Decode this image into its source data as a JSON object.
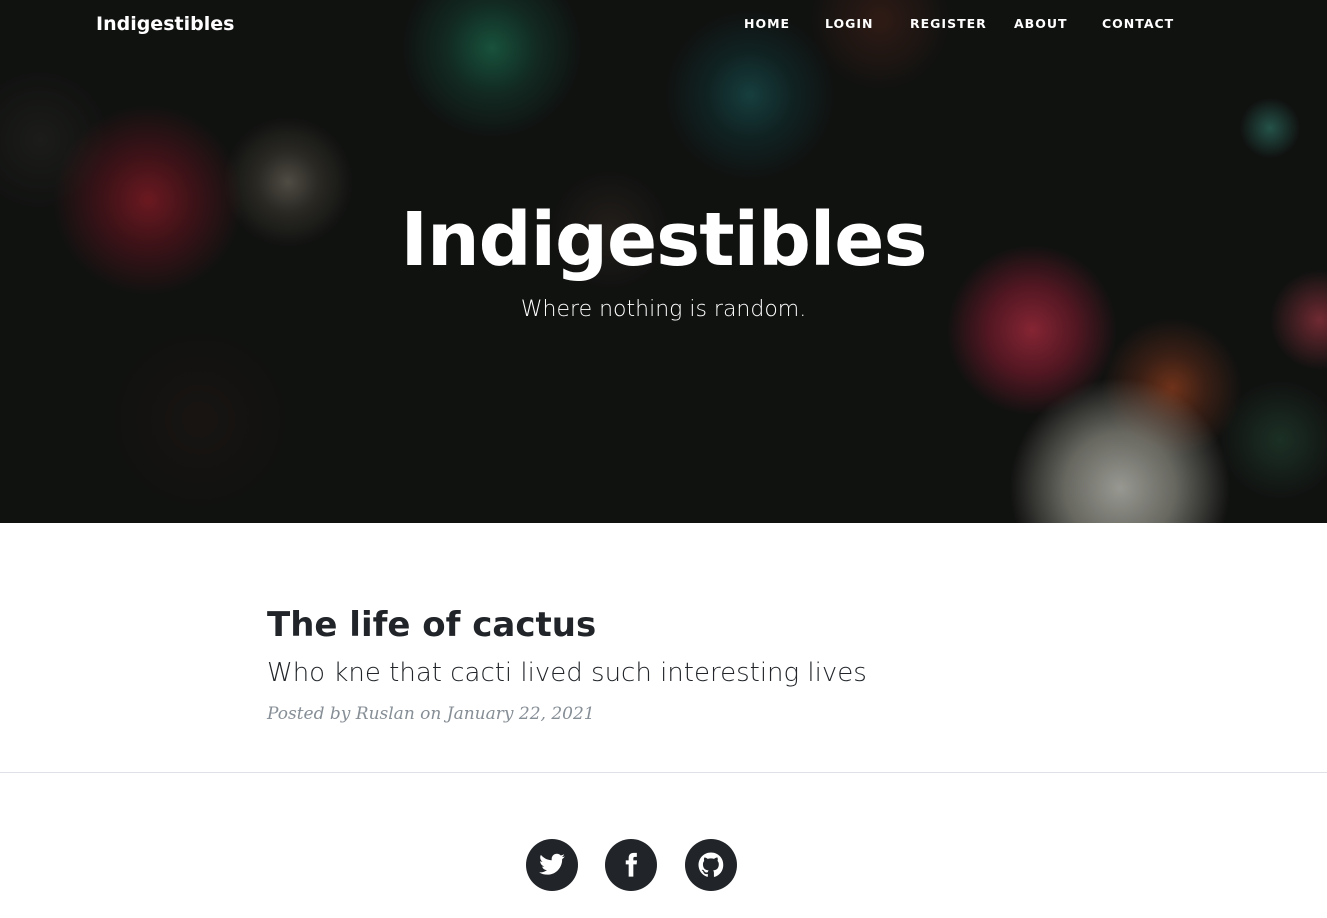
{
  "navbar": {
    "brand": "Indigestibles",
    "items": [
      {
        "label": "HOME"
      },
      {
        "label": "LOGIN"
      },
      {
        "label": "REGISTER"
      },
      {
        "label": "ABOUT"
      },
      {
        "label": "CONTACT"
      }
    ]
  },
  "hero": {
    "heading": "Indigestibles",
    "subheading": "Where nothing is random."
  },
  "post": {
    "title": "The life of cactus",
    "subtitle": "Who kne that cacti lived such interesting lives",
    "meta": "Posted by Ruslan on January 22, 2021"
  },
  "footer": {
    "social": [
      {
        "icon": "twitter-icon"
      },
      {
        "icon": "facebook-icon"
      },
      {
        "icon": "github-icon"
      }
    ]
  },
  "colors": {
    "text": "#212529",
    "muted": "#868e96",
    "divider": "#dee2e6",
    "social_bg": "#212529"
  }
}
